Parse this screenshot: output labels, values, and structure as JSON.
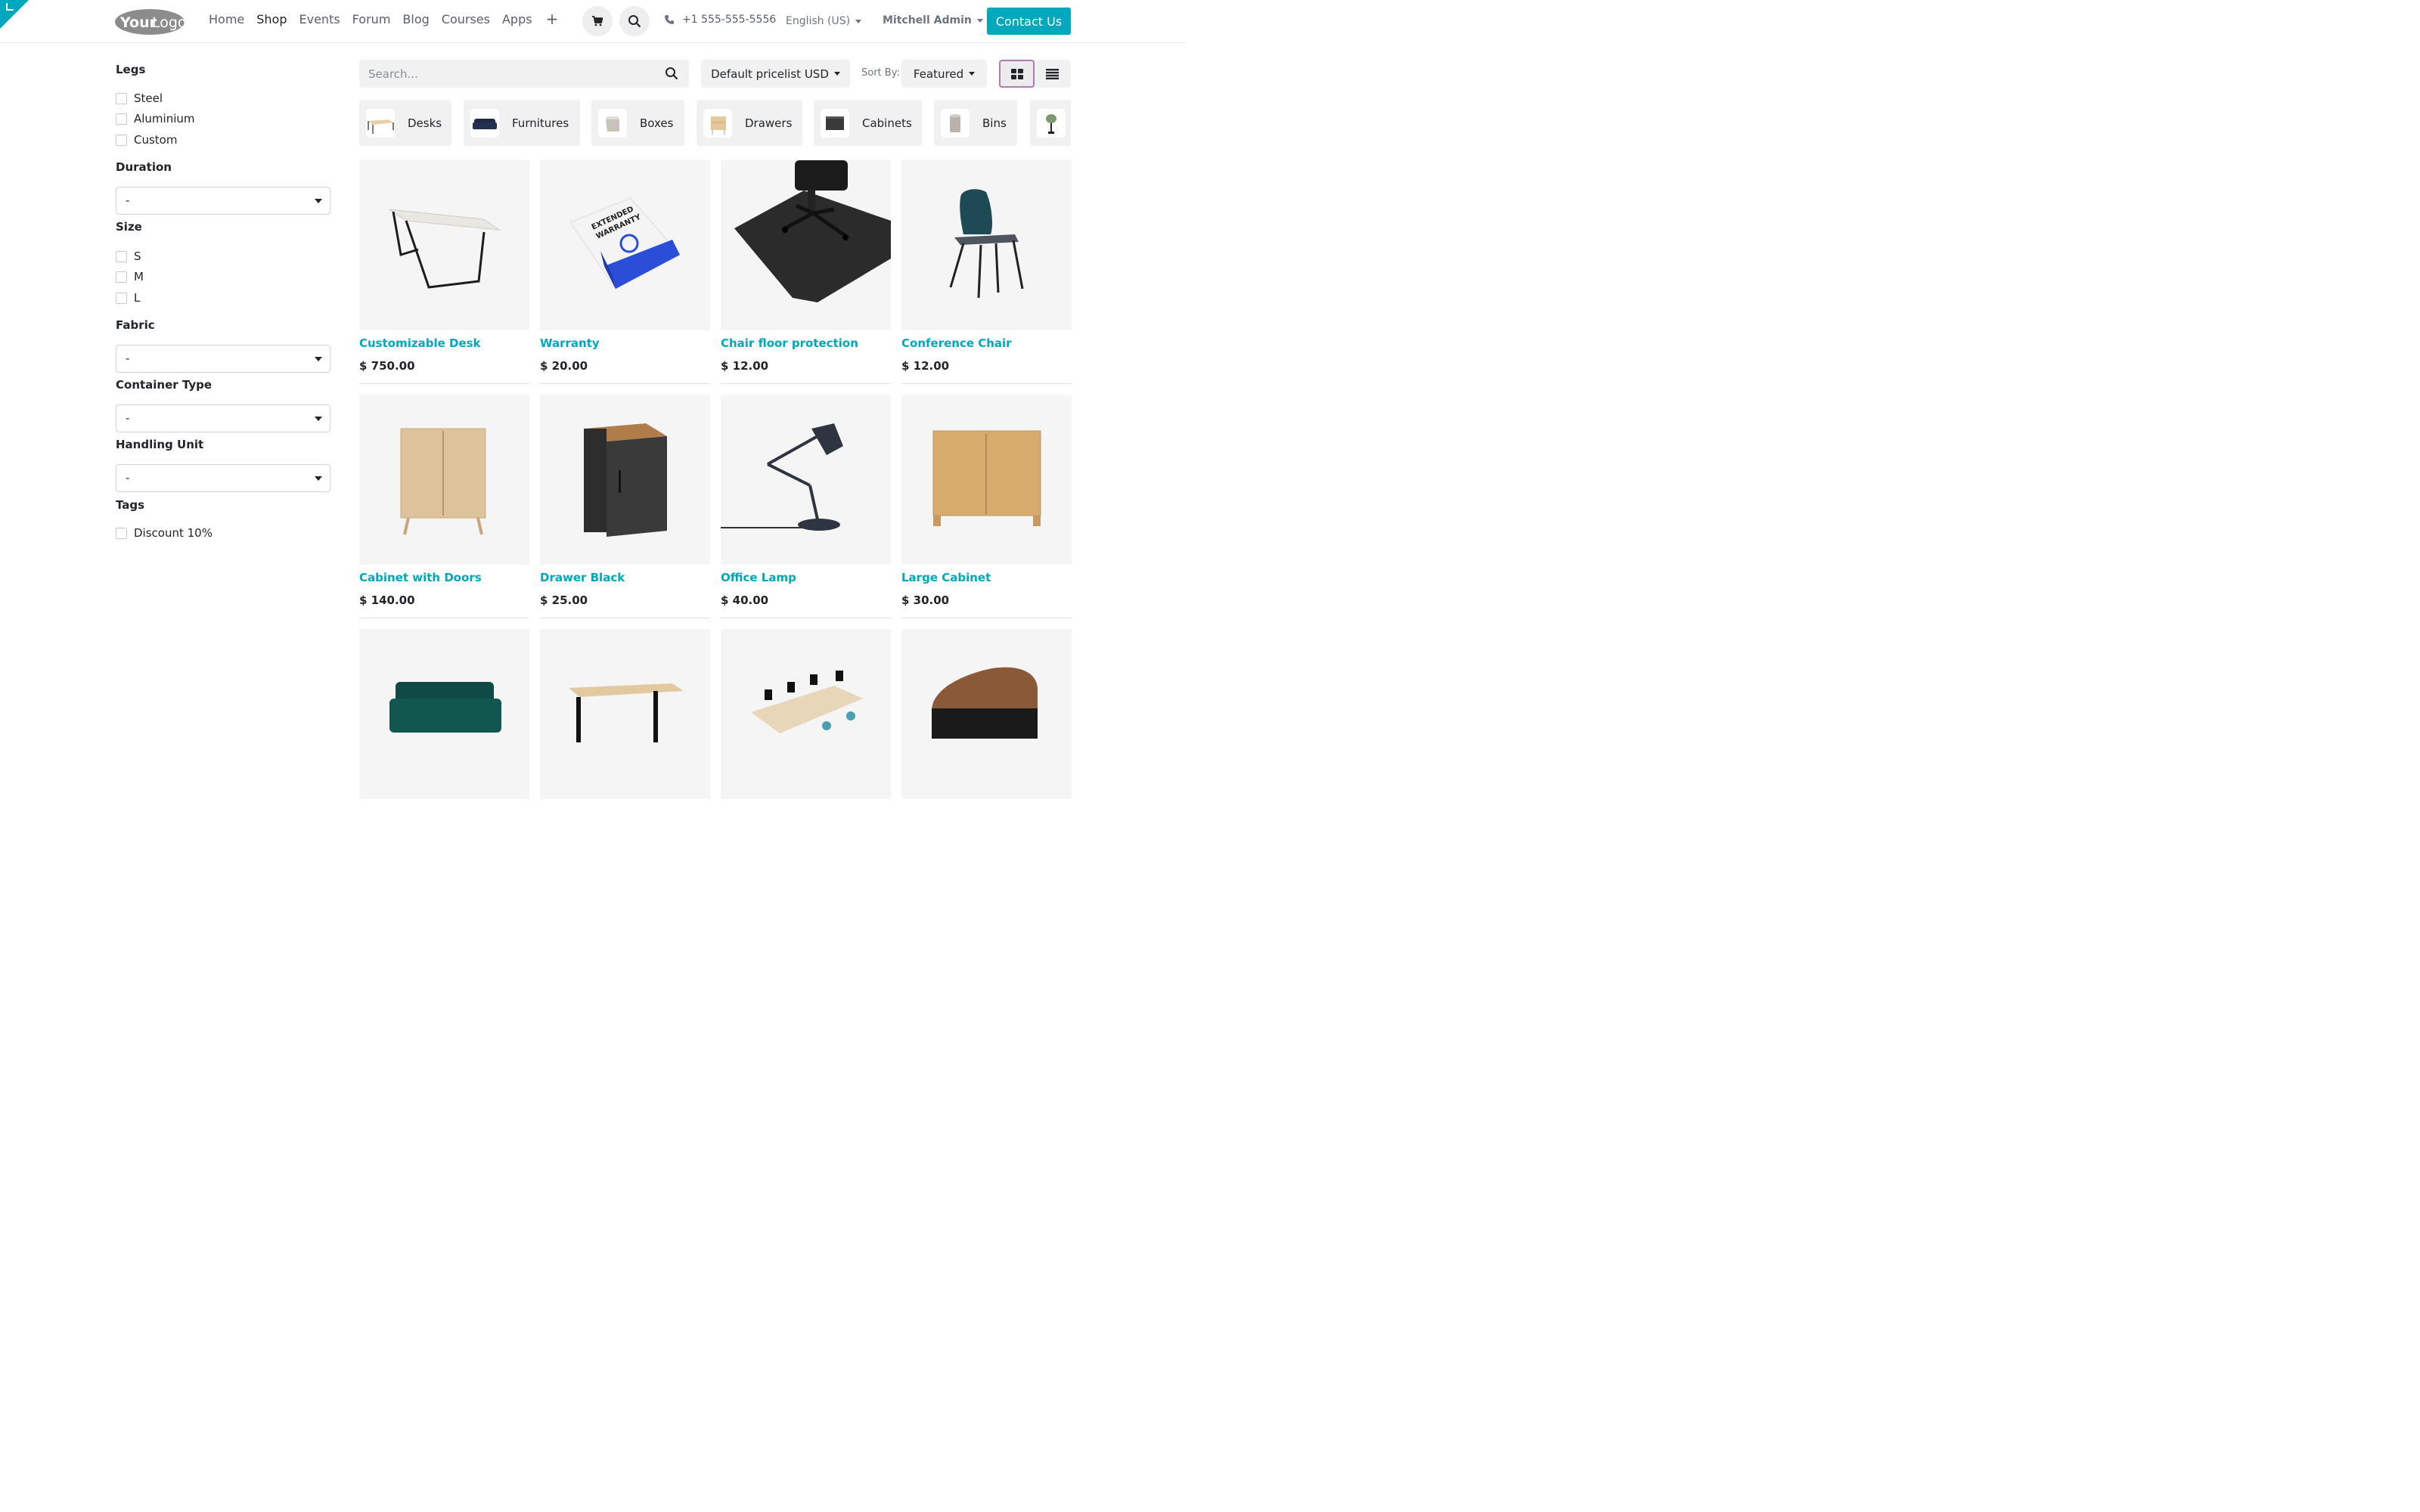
{
  "header": {
    "logo": {
      "text_a": "Your",
      "text_b": "Logo"
    },
    "nav": [
      "Home",
      "Shop",
      "Events",
      "Forum",
      "Blog",
      "Courses",
      "Apps"
    ],
    "nav_active": "Shop",
    "plus": "+",
    "phone": "+1 555-555-5556",
    "language": "English (US)",
    "user": "Mitchell Admin",
    "contact": "Contact Us"
  },
  "filters": {
    "legs": {
      "title": "Legs",
      "options": [
        "Steel",
        "Aluminium",
        "Custom"
      ]
    },
    "duration": {
      "title": "Duration",
      "value": "-"
    },
    "size": {
      "title": "Size",
      "options": [
        "S",
        "M",
        "L"
      ]
    },
    "fabric": {
      "title": "Fabric",
      "value": "-"
    },
    "container": {
      "title": "Container Type",
      "value": "-"
    },
    "handling": {
      "title": "Handling Unit",
      "value": "-"
    },
    "tags": {
      "title": "Tags",
      "options": [
        "Discount 10%"
      ]
    }
  },
  "toolbar": {
    "search_placeholder": "Search...",
    "pricelist": "Default pricelist USD",
    "sort_label": "Sort By:",
    "sort_value": "Featured"
  },
  "categories": [
    "Desks",
    "Furnitures",
    "Boxes",
    "Drawers",
    "Cabinets",
    "Bins"
  ],
  "products": [
    {
      "name": "Customizable Desk",
      "price": "$ 750.00"
    },
    {
      "name": "Warranty",
      "price": "$ 20.00"
    },
    {
      "name": "Chair floor protection",
      "price": "$ 12.00"
    },
    {
      "name": "Conference Chair",
      "price": "$ 12.00"
    },
    {
      "name": "Cabinet with Doors",
      "price": "$ 140.00"
    },
    {
      "name": "Drawer Black",
      "price": "$ 25.00"
    },
    {
      "name": "Office Lamp",
      "price": "$ 40.00"
    },
    {
      "name": "Large Cabinet",
      "price": "$ 30.00"
    }
  ],
  "colors": {
    "accent": "#00a8bd",
    "view_active_border": "#b07bb0"
  },
  "icons": [
    "cart-icon",
    "search-icon",
    "phone-icon",
    "grid-view-icon",
    "list-view-icon"
  ]
}
